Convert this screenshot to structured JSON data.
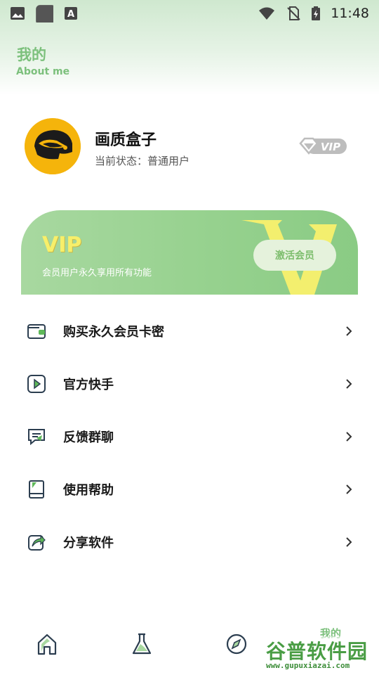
{
  "status_bar": {
    "time": "11:48",
    "left_icons": [
      "image-icon",
      "app-square-icon",
      "font-a-icon"
    ],
    "right_icons": [
      "wifi-icon",
      "no-sim-icon",
      "battery-charging-icon"
    ]
  },
  "header": {
    "title": "我的",
    "subtitle": "About me"
  },
  "profile": {
    "name": "画质盒子",
    "status": "当前状态：普通用户",
    "badge_text": "VIP"
  },
  "vip_banner": {
    "title": "VIP",
    "description": "会员用户永久享用所有功能",
    "activate_label": "激活会员",
    "decor_letter": "V"
  },
  "menu": {
    "items": [
      {
        "label": "购买永久会员卡密",
        "icon": "wallet-icon"
      },
      {
        "label": "官方快手",
        "icon": "play-video-icon"
      },
      {
        "label": "反馈群聊",
        "icon": "chat-icon"
      },
      {
        "label": "使用帮助",
        "icon": "book-icon"
      },
      {
        "label": "分享软件",
        "icon": "share-icon"
      }
    ]
  },
  "bottom_nav": {
    "items": [
      {
        "name": "home",
        "icon": "home-icon"
      },
      {
        "name": "lab",
        "icon": "flask-icon"
      },
      {
        "name": "discover",
        "icon": "compass-icon"
      },
      {
        "name": "me",
        "label": "我的"
      }
    ],
    "active": "me"
  },
  "watermark": {
    "title": "谷普软件园",
    "url": "www.gupuxiazai.com"
  },
  "colors": {
    "accent": "#7cc07c",
    "vip_yellow": "#f7ef6a",
    "banner_green": "#98d290",
    "button_bg": "#e5f2dc"
  }
}
